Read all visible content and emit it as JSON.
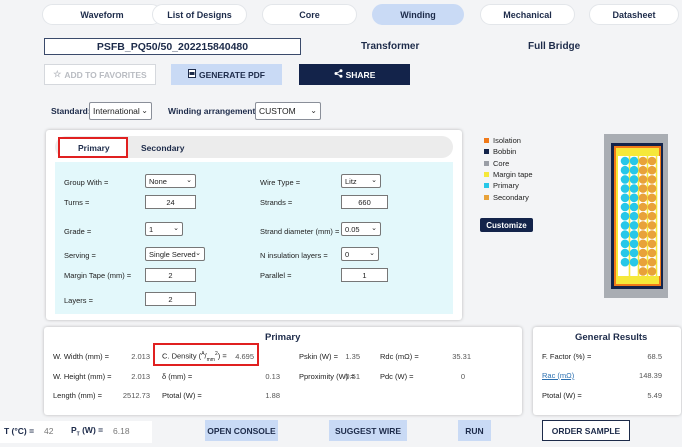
{
  "tabs": [
    {
      "label": "Waveform"
    },
    {
      "label": "List of Designs"
    },
    {
      "label": "Core"
    },
    {
      "label": "Winding",
      "active": true
    },
    {
      "label": "Mechanical"
    },
    {
      "label": "Datasheet"
    }
  ],
  "header": {
    "design_name": "PSFB_PQ50/50_202215840480",
    "type_label": "Transformer",
    "topology_label": "Full Bridge"
  },
  "actions": {
    "favorites": "ADD TO FAVORITES",
    "generate_pdf": "GENERATE PDF",
    "share": "SHARE"
  },
  "standard": {
    "label": "Standard:",
    "value": "International"
  },
  "winding_arrangement": {
    "label": "Winding arrangement:",
    "value": "CUSTOM"
  },
  "subtabs": {
    "primary": "Primary",
    "secondary": "Secondary"
  },
  "form": {
    "group_with": {
      "label": "Group With =",
      "value": "None"
    },
    "turns": {
      "label": "Turns =",
      "value": "24"
    },
    "grade": {
      "label": "Grade =",
      "value": "1"
    },
    "serving": {
      "label": "Serving =",
      "value": "Single Served"
    },
    "margin_tape": {
      "label": "Margin Tape (mm) =",
      "value": "2"
    },
    "layers": {
      "label": "Layers =",
      "value": "2"
    },
    "wire_type": {
      "label": "Wire Type =",
      "value": "Litz"
    },
    "strands": {
      "label": "Strands =",
      "value": "660"
    },
    "strand_diameter": {
      "label": "Strand diameter (mm) =",
      "value": "0.05"
    },
    "n_insulation_layers": {
      "label": "N insulation layers =",
      "value": "0"
    },
    "parallel": {
      "label": "Parallel =",
      "value": "1"
    }
  },
  "legend": [
    {
      "label": "Isolation",
      "color": "#f07a1a"
    },
    {
      "label": "Bobbin",
      "color": "#13234a"
    },
    {
      "label": "Core",
      "color": "#9a9ea6"
    },
    {
      "label": "Margin tape",
      "color": "#f5e83a"
    },
    {
      "label": "Primary",
      "color": "#27c7e8"
    },
    {
      "label": "Secondary",
      "color": "#e8a23a"
    }
  ],
  "customize_label": "Customize",
  "primary_results": {
    "title": "Primary",
    "w_width": {
      "label": "W. Width (mm) =",
      "value": "2.013"
    },
    "w_height": {
      "label": "W. Height (mm) =",
      "value": "2.013"
    },
    "length": {
      "label": "Length (mm) =",
      "value": "2512.73"
    },
    "c_density": {
      "label_pre": "C. Density (",
      "label_a": "A",
      "label_mm": "mm",
      "label_post": ") =",
      "value": "4.695"
    },
    "delta": {
      "label": "δ (mm) =",
      "value": "0.13"
    },
    "ptotal": {
      "label": "Ptotal (W) =",
      "value": "1.88"
    },
    "pskin": {
      "label": "Pskin (W) =",
      "value": "1.35"
    },
    "pproximity": {
      "label": "Pproximity (W) =",
      "value": "0.51"
    },
    "rdc": {
      "label": "Rdc (mΩ) =",
      "value": "35.31"
    },
    "pdc": {
      "label": "Pdc (W) =",
      "value": "0"
    }
  },
  "general_results": {
    "title": "General Results",
    "f_factor": {
      "label": "F. Factor (%) =",
      "value": "68.5"
    },
    "rac": {
      "label": "Rac (mΩ)",
      "value": "148.39"
    },
    "ptotal": {
      "label": "Ptotal (W) =",
      "value": "5.49"
    }
  },
  "footer": {
    "temp_label": "T (°C) =",
    "temp_value": "42",
    "pt_label_p": "P",
    "pt_label_sub": "T",
    "pt_label_post": " (W) =",
    "pt_value": "6.18",
    "open_console": "OPEN CONSOLE",
    "suggest_wire": "SUGGEST WIRE",
    "run": "RUN",
    "order_sample": "ORDER SAMPLE"
  }
}
